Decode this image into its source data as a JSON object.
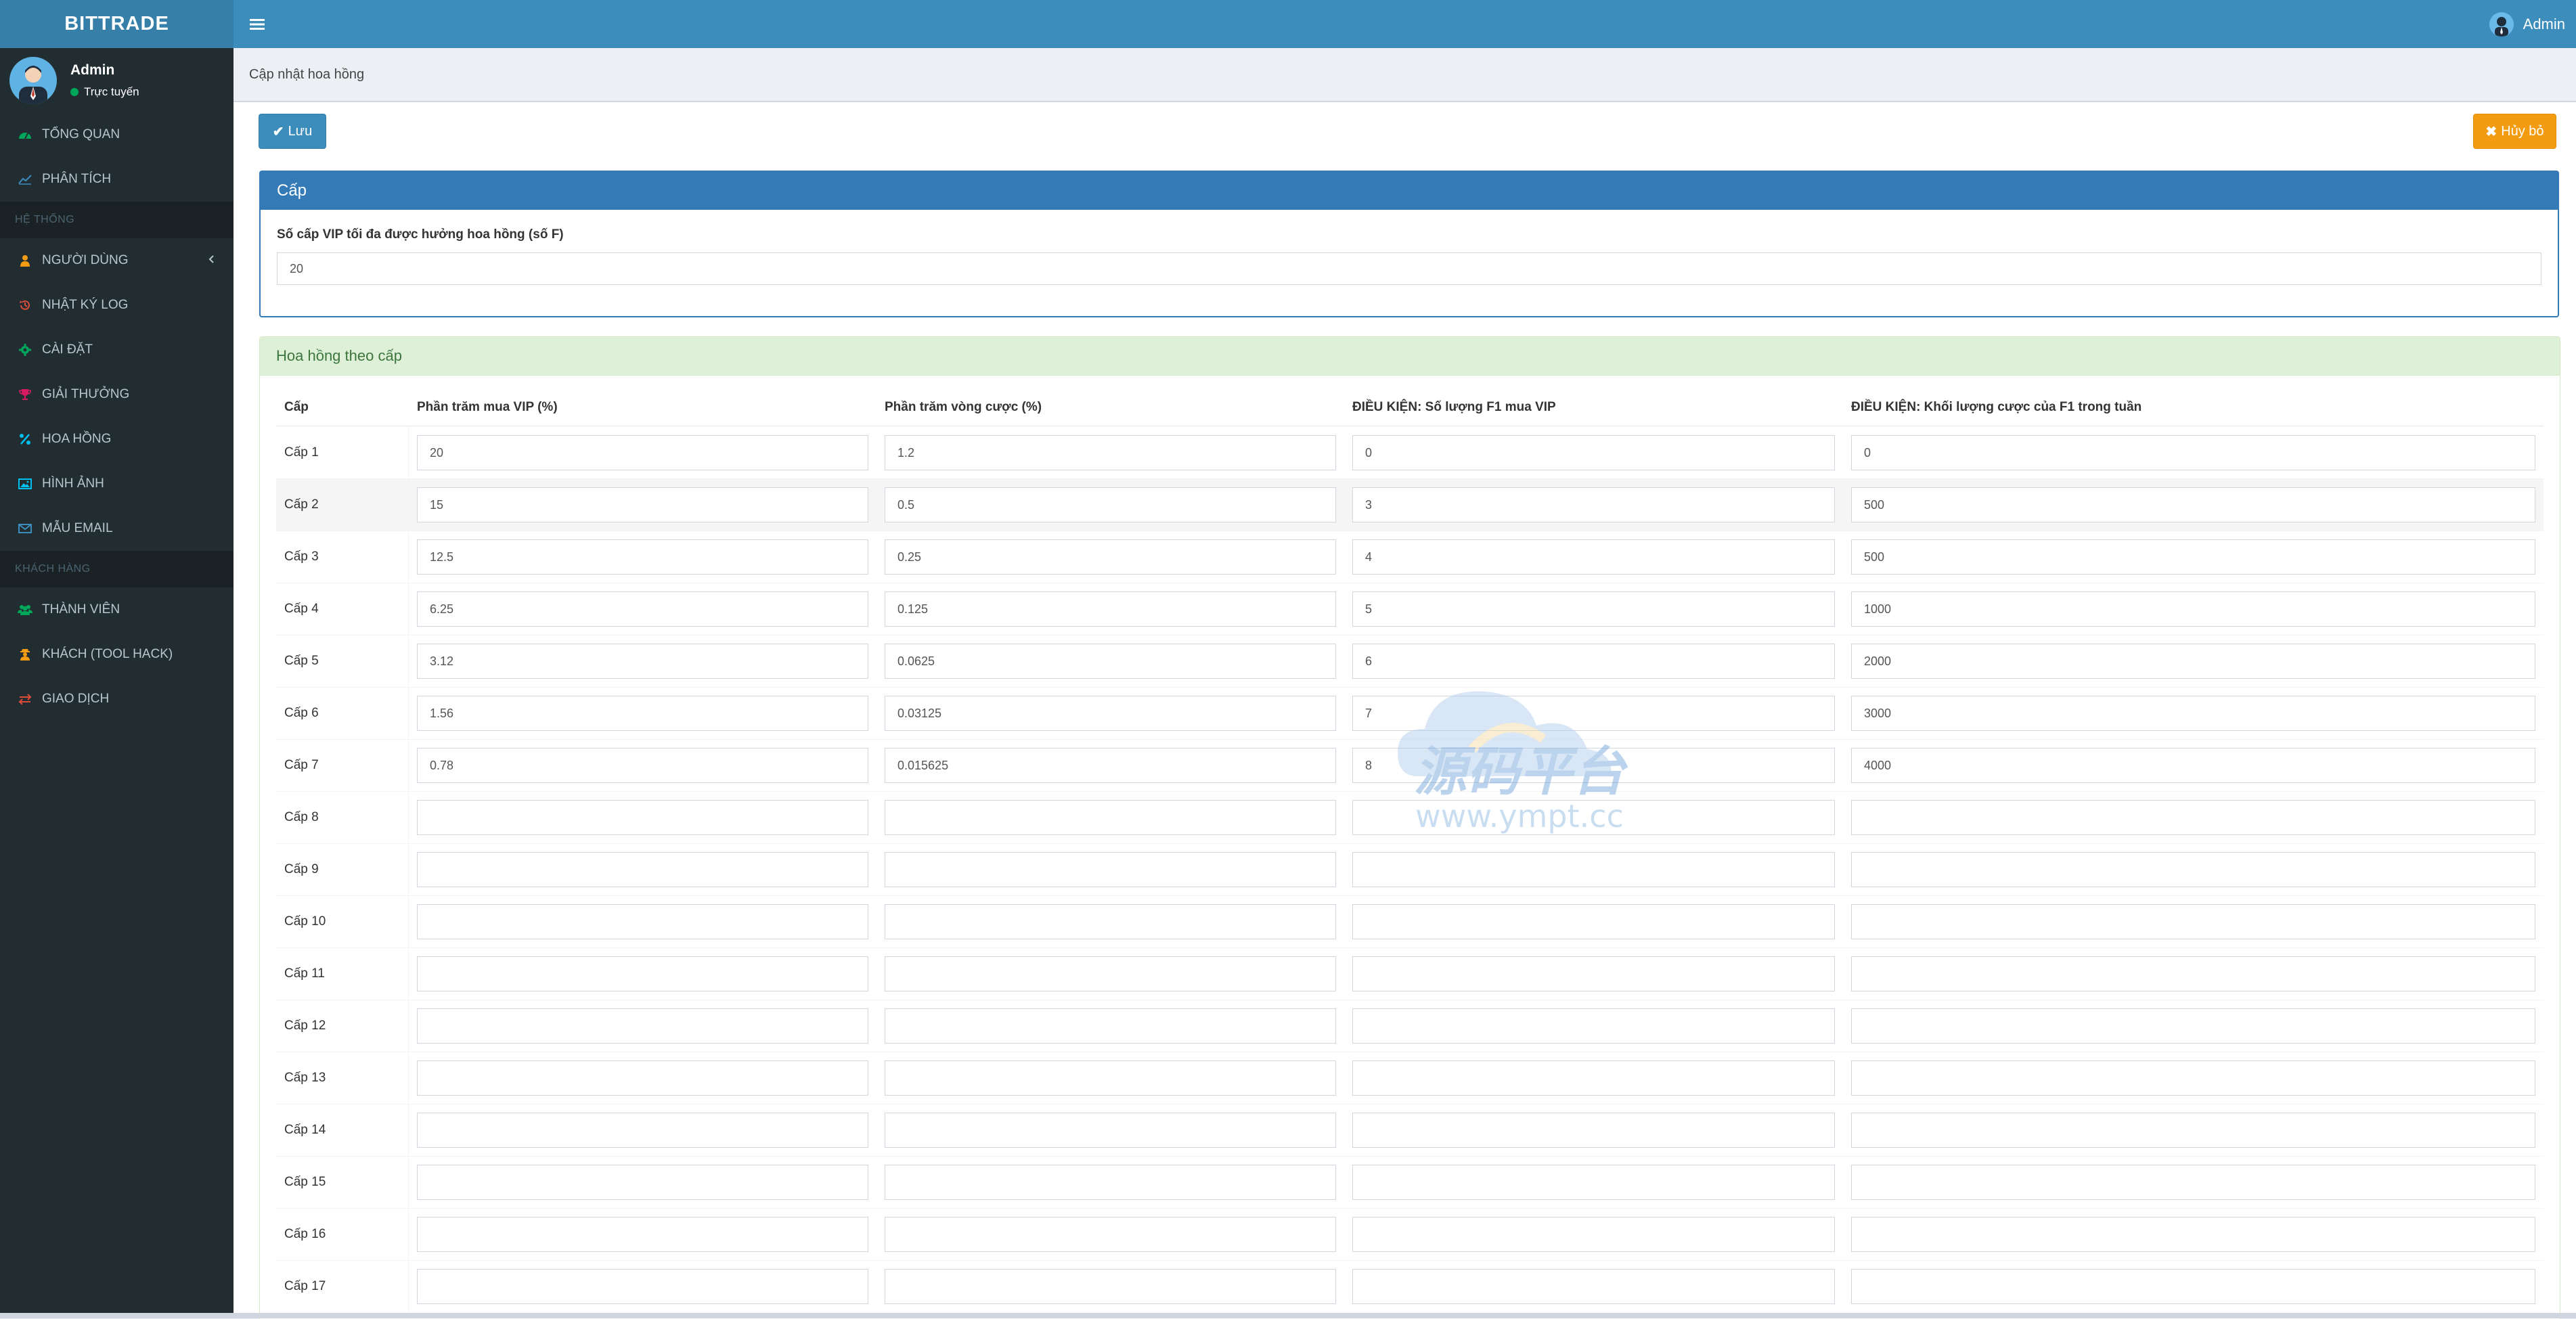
{
  "app": {
    "logo": "BITTRADE"
  },
  "header": {
    "user_name": "Admin"
  },
  "sidebar": {
    "user": {
      "name": "Admin",
      "status": "Trực tuyến"
    },
    "items_main": [
      {
        "label": "TỔNG QUAN",
        "icon": "dashboard-icon"
      },
      {
        "label": "PHÂN TÍCH",
        "icon": "line-chart-icon"
      }
    ],
    "header_system": "HỆ THỐNG",
    "items_system": [
      {
        "label": "NGƯỜI DÙNG",
        "icon": "user-icon"
      },
      {
        "label": "NHẬT KÝ LOG",
        "icon": "history-icon"
      },
      {
        "label": "CÀI ĐẶT",
        "icon": "gear-icon"
      },
      {
        "label": "GIẢI THƯỞNG",
        "icon": "trophy-icon"
      },
      {
        "label": "HOA HỒNG",
        "icon": "percent-icon"
      },
      {
        "label": "HÌNH ẢNH",
        "icon": "image-icon"
      },
      {
        "label": "MẪU EMAIL",
        "icon": "envelope-icon"
      }
    ],
    "header_customers": "KHÁCH HÀNG",
    "items_customers": [
      {
        "label": "THÀNH VIÊN",
        "icon": "users-icon"
      },
      {
        "label": "KHÁCH (TOOL HACK)",
        "icon": "user-secret-icon"
      },
      {
        "label": "GIAO DỊCH",
        "icon": "exchange-icon"
      }
    ]
  },
  "breadcrumb": "Cập nhật hoa hồng",
  "toolbar": {
    "save_label": "Lưu",
    "cancel_label": "Hủy bỏ"
  },
  "level_panel": {
    "title": "Cấp",
    "field_label": "Số cấp VIP tối đa được hưởng hoa hồng (số F)",
    "field_value": "20"
  },
  "commission_panel": {
    "title": "Hoa hồng theo cấp",
    "columns": [
      "Cấp",
      "Phần trăm mua VIP (%)",
      "Phần trăm vòng cược (%)",
      "ĐIỀU KIỆN: Số lượng F1 mua VIP",
      "ĐIỀU KIỆN: Khối lượng cược của F1 trong tuần"
    ],
    "rows": [
      {
        "level": "Cấp 1",
        "vip": "20",
        "bet": "1.2",
        "f1_count": "0",
        "f1_volume": "0"
      },
      {
        "level": "Cấp 2",
        "vip": "15",
        "bet": "0.5",
        "f1_count": "3",
        "f1_volume": "500"
      },
      {
        "level": "Cấp 3",
        "vip": "12.5",
        "bet": "0.25",
        "f1_count": "4",
        "f1_volume": "500"
      },
      {
        "level": "Cấp 4",
        "vip": "6.25",
        "bet": "0.125",
        "f1_count": "5",
        "f1_volume": "1000"
      },
      {
        "level": "Cấp 5",
        "vip": "3.12",
        "bet": "0.0625",
        "f1_count": "6",
        "f1_volume": "2000"
      },
      {
        "level": "Cấp 6",
        "vip": "1.56",
        "bet": "0.03125",
        "f1_count": "7",
        "f1_volume": "3000"
      },
      {
        "level": "Cấp 7",
        "vip": "0.78",
        "bet": "0.015625",
        "f1_count": "8",
        "f1_volume": "4000"
      },
      {
        "level": "Cấp 8",
        "vip": "",
        "bet": "",
        "f1_count": "",
        "f1_volume": ""
      },
      {
        "level": "Cấp 9",
        "vip": "",
        "bet": "",
        "f1_count": "",
        "f1_volume": ""
      },
      {
        "level": "Cấp 10",
        "vip": "",
        "bet": "",
        "f1_count": "",
        "f1_volume": ""
      },
      {
        "level": "Cấp 11",
        "vip": "",
        "bet": "",
        "f1_count": "",
        "f1_volume": ""
      },
      {
        "level": "Cấp 12",
        "vip": "",
        "bet": "",
        "f1_count": "",
        "f1_volume": ""
      },
      {
        "level": "Cấp 13",
        "vip": "",
        "bet": "",
        "f1_count": "",
        "f1_volume": ""
      },
      {
        "level": "Cấp 14",
        "vip": "",
        "bet": "",
        "f1_count": "",
        "f1_volume": ""
      },
      {
        "level": "Cấp 15",
        "vip": "",
        "bet": "",
        "f1_count": "",
        "f1_volume": ""
      },
      {
        "level": "Cấp 16",
        "vip": "",
        "bet": "",
        "f1_count": "",
        "f1_volume": ""
      },
      {
        "level": "Cấp 17",
        "vip": "",
        "bet": "",
        "f1_count": "",
        "f1_volume": ""
      }
    ]
  },
  "watermark": {
    "line1": "源码平台",
    "line2": "www.ympt.cc"
  },
  "colors": {
    "header": "#3c8dbc",
    "logo_bg": "#367fa9",
    "sidebar": "#222d32",
    "primary": "#337ab7",
    "warning": "#f39c12",
    "success_bg": "#dff0d8",
    "online": "#00a65a"
  }
}
